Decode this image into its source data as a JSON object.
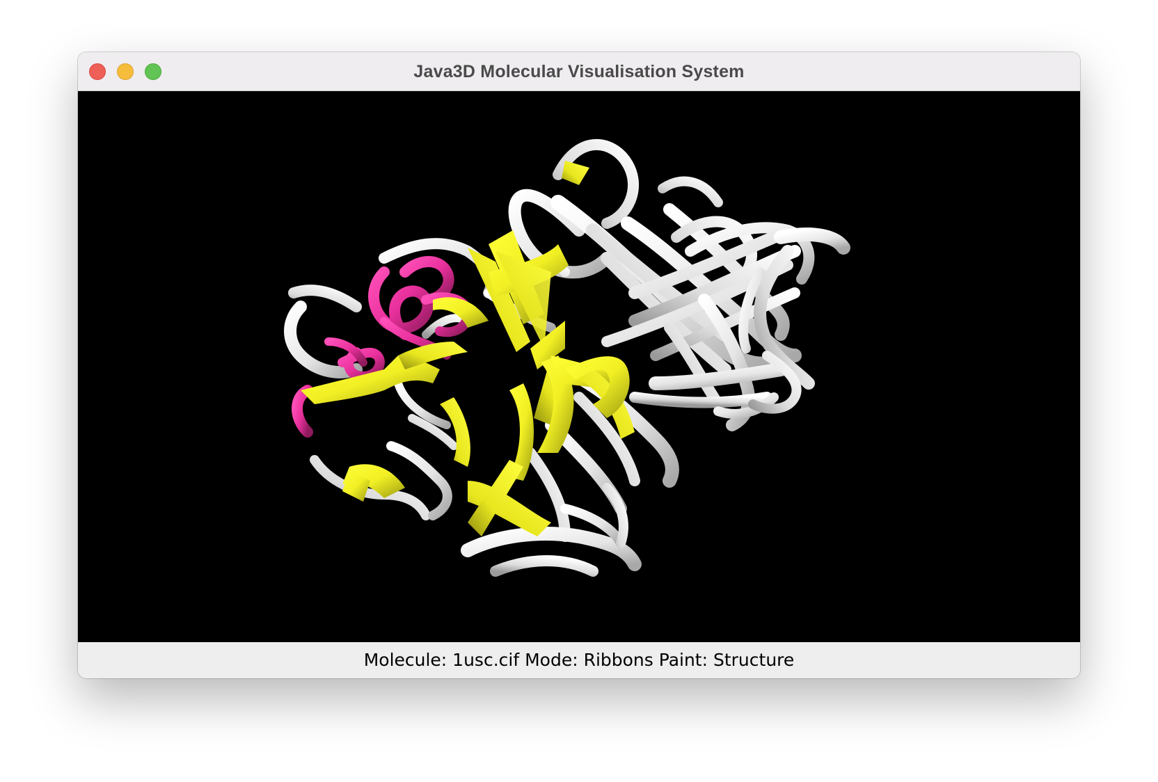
{
  "window": {
    "title": "Java3D Molecular Visualisation System"
  },
  "viewer": {
    "background_color": "#000000",
    "structure_colors": {
      "coil": "#ffffff",
      "strand": "#f8f820",
      "helix": "#e8309c"
    }
  },
  "statusbar": {
    "text": "Molecule: 1usc.cif Mode: Ribbons Paint: Structure"
  }
}
